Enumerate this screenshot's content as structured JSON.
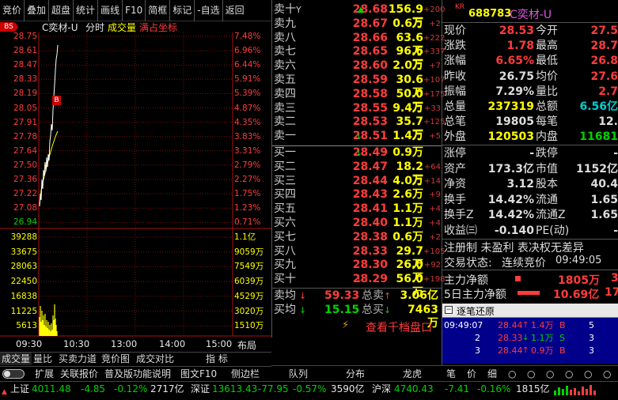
{
  "toolbar": {
    "items": [
      "竞价",
      "叠加",
      "超盘",
      "统计",
      "画线",
      "F10",
      "简框",
      "标记",
      "-自选",
      "返回"
    ]
  },
  "chart": {
    "stock_label": "C奕材-U",
    "mode_label": "分时",
    "volume_label": "成交量",
    "coord_label": "满占坐标",
    "bs_badge": "BS",
    "b_marker": "B",
    "price_ticks": [
      "28.75",
      "28.61",
      "28.47",
      "28.33",
      "28.19",
      "28.05",
      "27.91",
      "27.78",
      "27.64",
      "27.50",
      "27.36",
      "27.22",
      "27.08",
      "26.94"
    ],
    "pct_ticks": [
      "7.48%",
      "6.96%",
      "6.44%",
      "5.91%",
      "5.39%",
      "4.87%",
      "4.35%",
      "3.83%",
      "3.31%",
      "2.79%",
      "2.27%",
      "1.75%",
      "1.23%",
      "0.71%"
    ],
    "vol_ticks_left": [
      "39288",
      "33675",
      "28063",
      "22450",
      "16838",
      "11225",
      "5613"
    ],
    "vol_ticks_right": [
      "1.1亿",
      "9059万",
      "7549万",
      "6039万",
      "4529万",
      "3020万",
      "1510万"
    ],
    "time_labels": [
      "09:30",
      "10:30",
      "13:00",
      "14:00",
      "15:00"
    ],
    "layout_label": "布局"
  },
  "chart_tabs": [
    "成交量",
    "量比",
    "买卖力道",
    "竞价图",
    "成交对比",
    "指 标"
  ],
  "func_tabs": [
    "扩展",
    "关联报价",
    "普及版功能说明",
    "图文F10",
    "侧边栏"
  ],
  "orderbook": {
    "asks": [
      {
        "label": "卖十",
        "price": "28.68",
        "vol": "156.9万",
        "chg": "+200",
        "flag": "Y"
      },
      {
        "label": "卖九",
        "price": "28.67",
        "vol": "0.6万",
        "chg": "+2"
      },
      {
        "label": "卖八",
        "price": "28.66",
        "vol": "63.6万",
        "chg": "+222"
      },
      {
        "label": "卖七",
        "price": "28.65",
        "vol": "96.6万",
        "chg": "+337"
      },
      {
        "label": "卖六",
        "price": "28.60",
        "vol": "2.0万",
        "chg": "+7"
      },
      {
        "label": "卖五",
        "price": "28.59",
        "vol": "30.6万",
        "chg": "+107"
      },
      {
        "label": "卖四",
        "price": "28.58",
        "vol": "50.0万",
        "chg": "+175"
      },
      {
        "label": "卖三",
        "price": "28.55",
        "vol": "9.4万",
        "chg": "+33"
      },
      {
        "label": "卖二",
        "price": "28.53",
        "vol": "35.7万",
        "chg": "+125"
      },
      {
        "label": "卖一",
        "price": "28.51",
        "vol": "1.4万",
        "chg": "+5"
      }
    ],
    "bids": [
      {
        "label": "买一",
        "price": "28.49",
        "vol": "0.9万",
        "chg": ""
      },
      {
        "label": "买二",
        "price": "28.47",
        "vol": "18.2万",
        "chg": "+64"
      },
      {
        "label": "买三",
        "price": "28.44",
        "vol": "4.0万",
        "chg": "+14"
      },
      {
        "label": "买四",
        "price": "28.43",
        "vol": "2.6万",
        "chg": "+9"
      },
      {
        "label": "买五",
        "price": "28.41",
        "vol": "1.1万",
        "chg": "+4"
      },
      {
        "label": "买六",
        "price": "28.40",
        "vol": "1.1万",
        "chg": "+4"
      },
      {
        "label": "买七",
        "price": "28.38",
        "vol": "0.6万",
        "chg": "+2"
      },
      {
        "label": "买八",
        "price": "28.33",
        "vol": "29.7万",
        "chg": "+105"
      },
      {
        "label": "买九",
        "price": "28.30",
        "vol": "26.0万",
        "chg": "+92"
      },
      {
        "label": "买十",
        "price": "28.29",
        "vol": "56.0万",
        "chg": "+198"
      }
    ],
    "ask_avg_label": "卖均",
    "ask_avg_price": "59.33",
    "ask_total_label": "总卖",
    "ask_total": "3.06亿",
    "bid_avg_label": "买均",
    "bid_avg_price": "15.15",
    "bid_total_label": "总买",
    "bid_total": "7463万",
    "ten_level_link": "查看千档盘口"
  },
  "quote": {
    "kr_badge": "KR",
    "code": "688783",
    "name": "C奕材-U",
    "rows": [
      {
        "l1": "现价",
        "v1": "28.53",
        "l2": "今开",
        "v2": "27.5"
      },
      {
        "l1": "涨跌",
        "v1": "1.78",
        "l2": "最高",
        "v2": "28.7"
      },
      {
        "l1": "涨幅",
        "v1": "6.65%",
        "l2": "最低",
        "v2": "26.8"
      },
      {
        "l1": "昨收",
        "v1": "26.75",
        "l2": "均价",
        "v2": "27.6"
      },
      {
        "l1": "振幅",
        "v1": "7.29%",
        "l2": "量比",
        "v2": "2.7"
      },
      {
        "l1": "总量",
        "v1": "237319",
        "l2": "总额",
        "v2": "6.56亿"
      },
      {
        "l1": "总笔",
        "v1": "19805",
        "l2": "每笔",
        "v2": "12."
      },
      {
        "l1": "外盘",
        "v1": "120503",
        "l2": "内盘",
        "v2": "11681"
      }
    ],
    "rows2": [
      {
        "l1": "涨停",
        "v1": "-",
        "l2": "跌停",
        "v2": "-"
      },
      {
        "l1": "资产",
        "v1": "173.3亿",
        "l2": "市值",
        "v2": "1152亿"
      },
      {
        "l1": "净资",
        "v1": "3.12",
        "l2": "股本",
        "v2": "40.4"
      },
      {
        "l1": "换手",
        "v1": "14.42%",
        "l2": "流通",
        "v2": "1.65"
      },
      {
        "l1": "换手Z",
        "v1": "14.42%",
        "l2": "流通Z",
        "v2": "1.65"
      },
      {
        "l1": "收益㈢",
        "v1": "-0.140",
        "l2": "PE(动)",
        "v2": "-"
      }
    ],
    "reg_note": "注册制 未盈利 表决权无差异",
    "trade_status_label": "交易状态:",
    "trade_status": "连续竞价",
    "trade_time": "09:49:05",
    "main_net_label": "主力净额",
    "main_net": "1805万",
    "main_net_extra": "3",
    "main_net5_label": "5日主力净额",
    "main_net5": "10.69亿",
    "main_net5_extra": "17"
  },
  "ticks": {
    "header": "逐笔还原",
    "rows": [
      {
        "time": "09:49:07",
        "price": "28.44",
        "vol": "1.4万",
        "side": "B",
        "n": "5"
      },
      {
        "time": "2",
        "price": "28.33",
        "vol": "1.1万",
        "side": "S",
        "n": "3"
      },
      {
        "time": "3",
        "price": "28.44",
        "vol": "0.9万",
        "side": "B",
        "n": "3"
      }
    ]
  },
  "bottom_tabs_mid": [
    "队列",
    "分布",
    "龙虎"
  ],
  "bottom_tabs_right": [
    "笔",
    "价",
    "细",
    "○",
    "○",
    "○",
    "○",
    "○",
    "○"
  ],
  "statusbar": {
    "idx1_name": "上证",
    "idx1_val": "4011.48",
    "idx1_chg": "-4.85",
    "idx1_pct": "-0.12%",
    "idx1_amt": "2717亿",
    "idx2_name": "深证",
    "idx2_val": "13613.43",
    "idx2_chg": "-77.95",
    "idx2_pct": "-0.57%",
    "idx2_amt": "3590亿",
    "idx3_name": "沪深",
    "idx3_val": "4740.43",
    "idx3_chg": "-7.41",
    "idx3_pct": "-0.16%",
    "idx3_amt": "1815亿"
  },
  "colors": {
    "up": "#ff3c3c",
    "down": "#00d200",
    "volume": "#ffff00",
    "price_line": "#ffffff",
    "avg_line": "#ffff00",
    "grid": "#7a1010"
  }
}
